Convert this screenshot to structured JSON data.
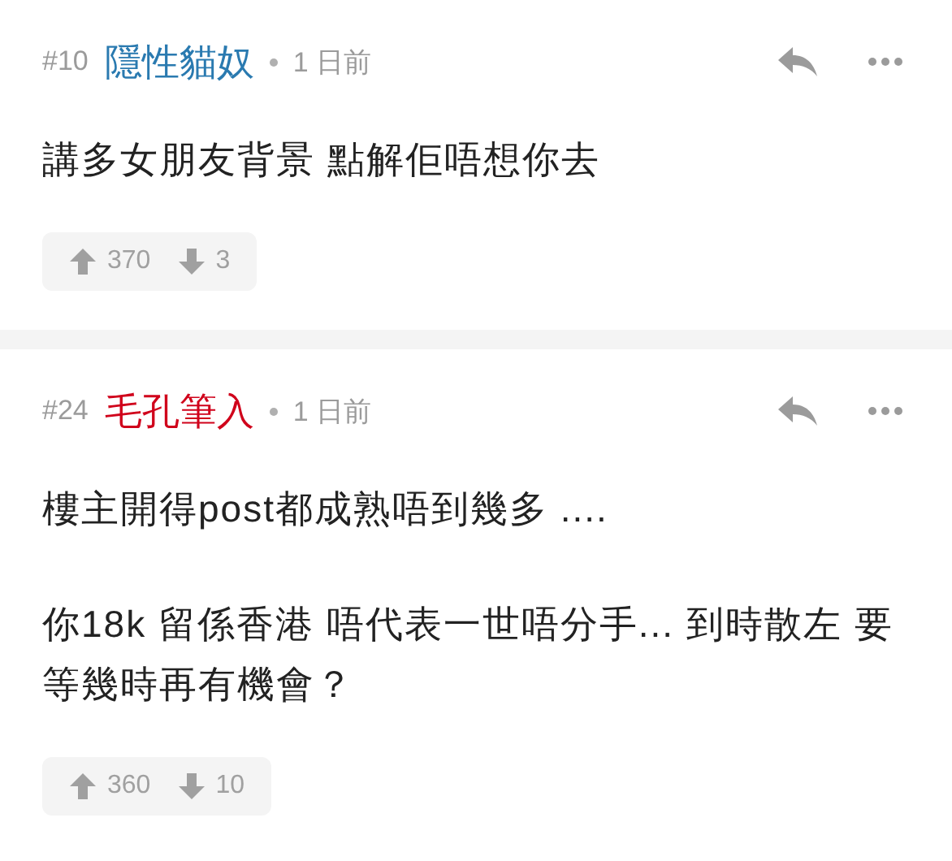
{
  "comments": [
    {
      "floor": "#10",
      "author": "隱性貓奴",
      "color": "#2a7ab0",
      "time": "1 日前",
      "paragraphs": [
        "講多女朋友背景 點解佢唔想你去"
      ],
      "upvotes": "370",
      "downvotes": "3"
    },
    {
      "floor": "#24",
      "author": "毛孔筆入",
      "color": "#d0021b",
      "time": "1 日前",
      "paragraphs": [
        "樓主開得post都成熟唔到幾多 ....",
        "你18k 留係香港 唔代表一世唔分手... 到時散左 要等幾時再有機會？"
      ],
      "upvotes": "360",
      "downvotes": "10"
    }
  ]
}
